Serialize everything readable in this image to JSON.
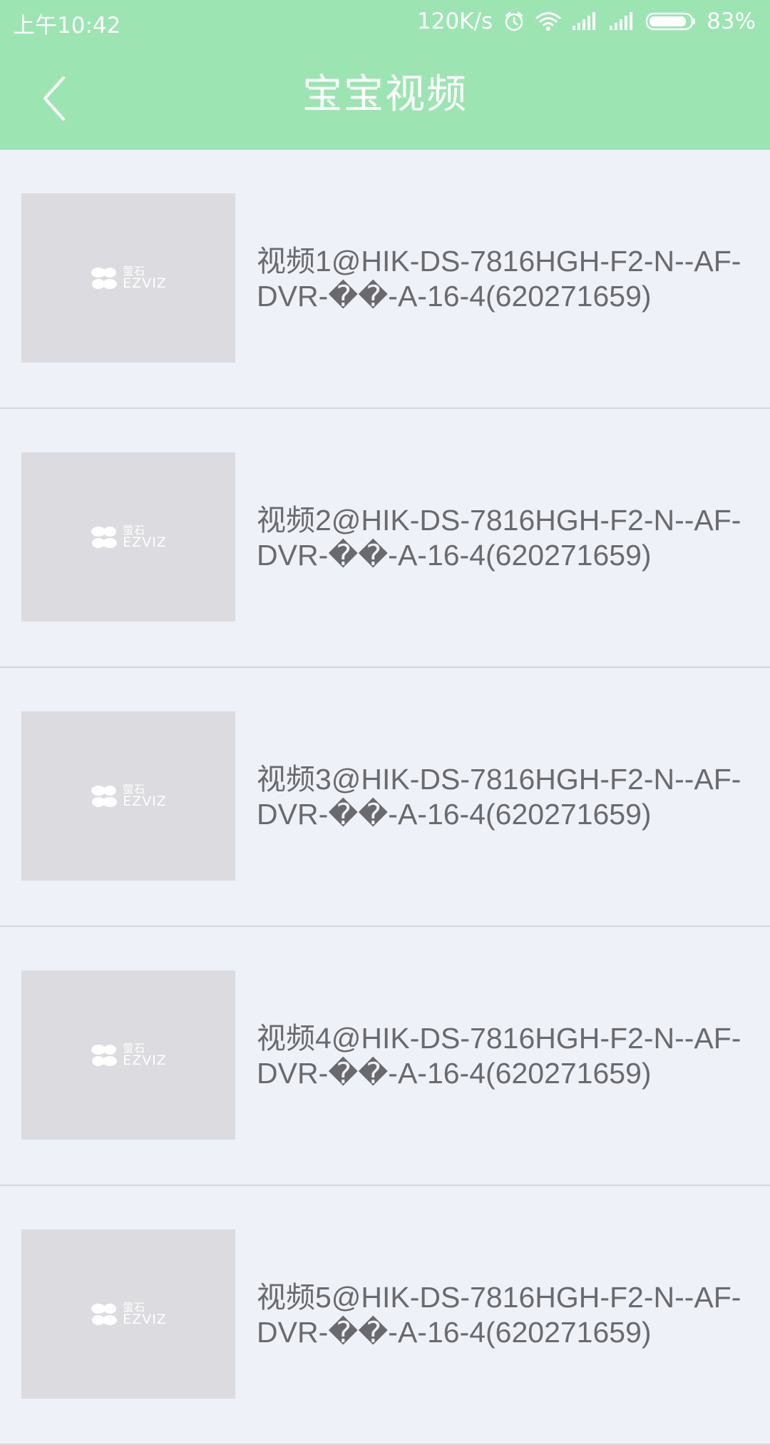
{
  "status_bar": {
    "time": "上午10:42",
    "network_speed": "120K/s",
    "battery": "83%",
    "icons": [
      "alarm-icon",
      "wifi-icon",
      "signal-icon",
      "signal-icon",
      "battery-icon"
    ]
  },
  "app_bar": {
    "title": "宝宝视频",
    "background_color": "#9de4b3",
    "back_icon": "chevron-left-icon"
  },
  "videos": [
    {
      "label": "视频1@HIK-DS-7816HGH-F2-N--AF-DVR-��-A-16-4(620271659)"
    },
    {
      "label": "视频2@HIK-DS-7816HGH-F2-N--AF-DVR-��-A-16-4(620271659)"
    },
    {
      "label": "视频3@HIK-DS-7816HGH-F2-N--AF-DVR-��-A-16-4(620271659)"
    },
    {
      "label": "视频4@HIK-DS-7816HGH-F2-N--AF-DVR-��-A-16-4(620271659)"
    },
    {
      "label": "视频5@HIK-DS-7816HGH-F2-N--AF-DVR-��-A-16-4(620271659)"
    }
  ],
  "thumbnail_logo": {
    "cn": "萤石",
    "en": "EZVIZ"
  }
}
